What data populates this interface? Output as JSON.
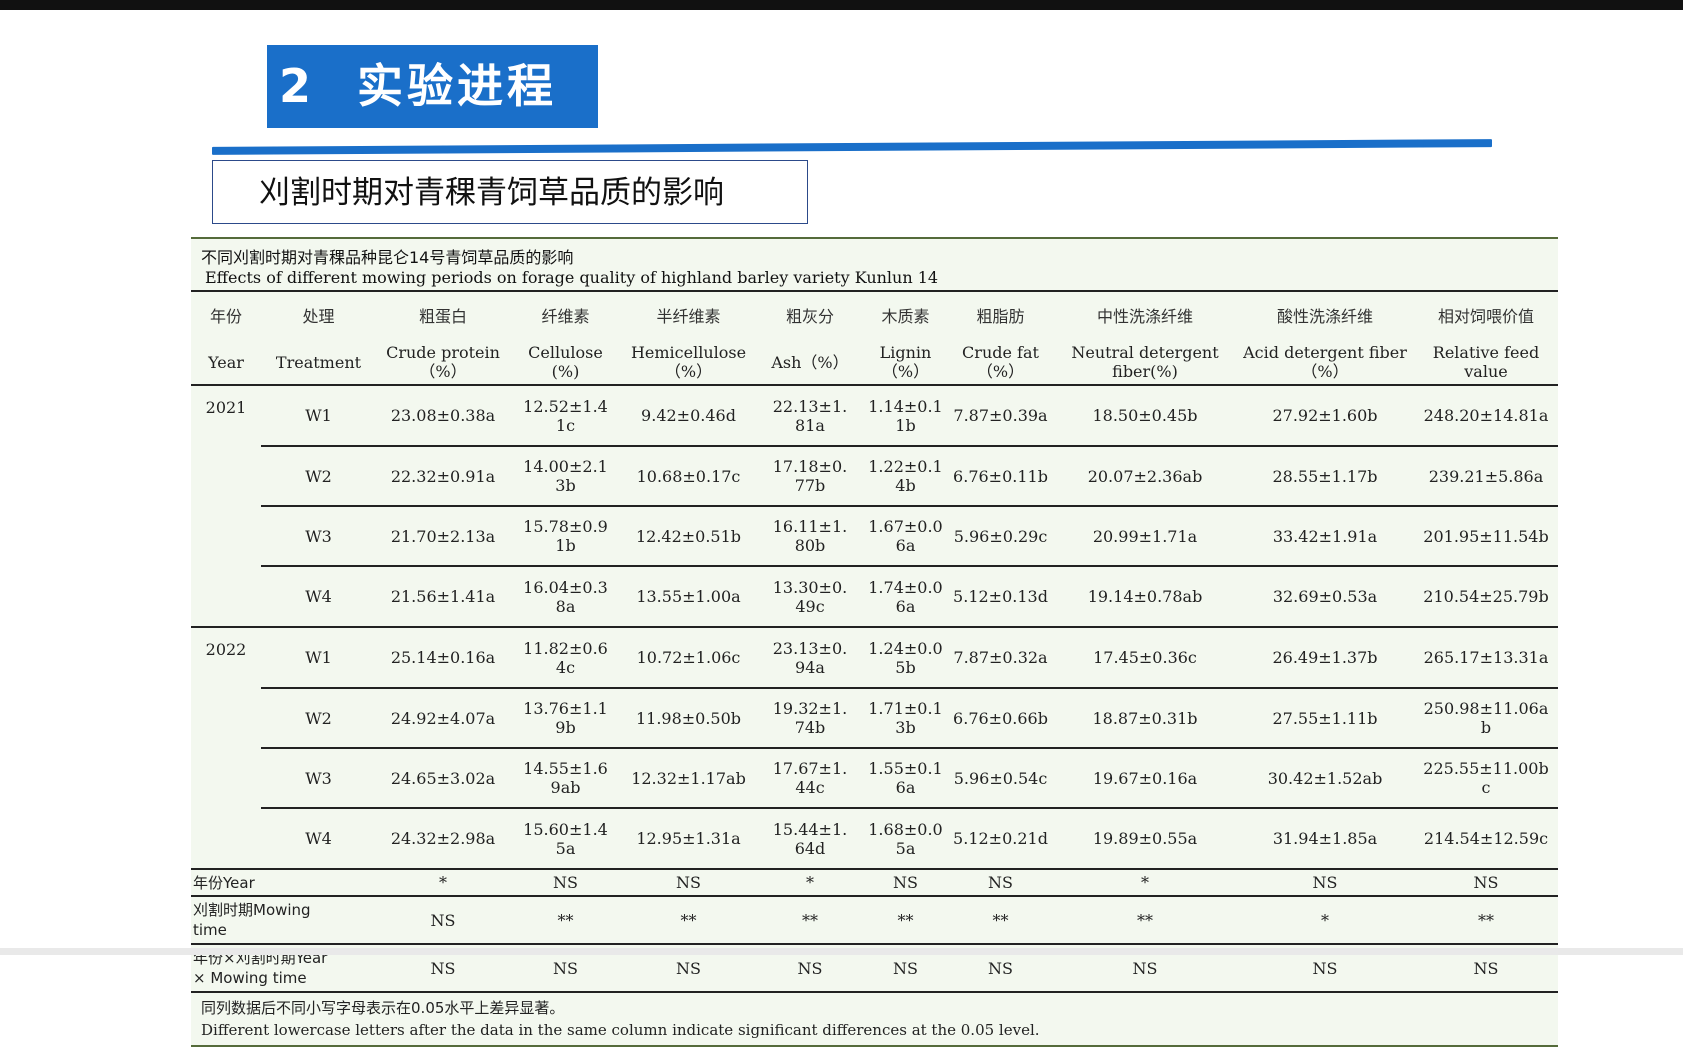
{
  "section": {
    "number": "2",
    "title": "实验进程"
  },
  "subtitle": "刈割时期对青稞青饲草品质的影响",
  "table": {
    "caption_cn": "不同刈割时期对青稞品种昆仑14号青饲草品质的影响",
    "caption_en": "Effects of different mowing periods on forage quality of highland barley variety Kunlun 14",
    "headers_cn": [
      "年份",
      "处理",
      "粗蛋白",
      "纤维素",
      "半纤维素",
      "粗灰分",
      "木质素",
      "粗脂肪",
      "中性洗涤纤维",
      "酸性洗涤纤维",
      "相对饲喂价值"
    ],
    "headers_en": [
      "Year",
      "Treatment",
      "Crude protein\n（%）",
      "Cellulose\n(%)",
      "Hemicellulose\n（%）",
      "Ash（%）",
      "Lignin\n（%）",
      "Crude fat\n（%）",
      "Neutral detergent\nfiber(%)",
      "Acid detergent fiber\n（%）",
      "Relative feed\nvalue"
    ],
    "rows": [
      [
        "2021",
        "W1",
        "23.08±0.38a",
        "12.52±1.4\n1c",
        "9.42±0.46d",
        "22.13±1.\n81a",
        "1.14±0.1\n1b",
        "7.87±0.39a",
        "18.50±0.45b",
        "27.92±1.60b",
        "248.20±14.81a"
      ],
      [
        "",
        "W2",
        "22.32±0.91a",
        "14.00±2.1\n3b",
        "10.68±0.17c",
        "17.18±0.\n77b",
        "1.22±0.1\n4b",
        "6.76±0.11b",
        "20.07±2.36ab",
        "28.55±1.17b",
        "239.21±5.86a"
      ],
      [
        "",
        "W3",
        "21.70±2.13a",
        "15.78±0.9\n1b",
        "12.42±0.51b",
        "16.11±1.\n80b",
        "1.67±0.0\n6a",
        "5.96±0.29c",
        "20.99±1.71a",
        "33.42±1.91a",
        "201.95±11.54b"
      ],
      [
        "",
        "W4",
        "21.56±1.41a",
        "16.04±0.3\n8a",
        "13.55±1.00a",
        "13.30±0.\n49c",
        "1.74±0.0\n6a",
        "5.12±0.13d",
        "19.14±0.78ab",
        "32.69±0.53a",
        "210.54±25.79b"
      ],
      [
        "2022",
        "W1",
        "25.14±0.16a",
        "11.82±0.6\n4c",
        "10.72±1.06c",
        "23.13±0.\n94a",
        "1.24±0.0\n5b",
        "7.87±0.32a",
        "17.45±0.36c",
        "26.49±1.37b",
        "265.17±13.31a"
      ],
      [
        "",
        "W2",
        "24.92±4.07a",
        "13.76±1.1\n9b",
        "11.98±0.50b",
        "19.32±1.\n74b",
        "1.71±0.1\n3b",
        "6.76±0.66b",
        "18.87±0.31b",
        "27.55±1.11b",
        "250.98±11.06a\nb"
      ],
      [
        "",
        "W3",
        "24.65±3.02a",
        "14.55±1.6\n9ab",
        "12.32±1.17ab",
        "17.67±1.\n44c",
        "1.55±0.1\n6a",
        "5.96±0.54c",
        "19.67±0.16a",
        "30.42±1.52ab",
        "225.55±11.00b\nc"
      ],
      [
        "",
        "W4",
        "24.32±2.98a",
        "15.60±1.4\n5a",
        "12.95±1.31a",
        "15.44±1.\n64d",
        "1.68±0.0\n5a",
        "5.12±0.21d",
        "19.89±0.55a",
        "31.94±1.85a",
        "214.54±12.59c"
      ]
    ],
    "stats": [
      {
        "label": "年份Year",
        "values": [
          "*",
          "NS",
          "NS",
          "*",
          "NS",
          "NS",
          "*",
          "NS",
          "NS"
        ]
      },
      {
        "label": "刈割时期Mowing\ntime",
        "values": [
          "NS",
          "**",
          "**",
          "**",
          "**",
          "**",
          "**",
          "*",
          "**"
        ]
      },
      {
        "label": "年份×刈割时期Year\n× Mowing time",
        "values": [
          "NS",
          "NS",
          "NS",
          "NS",
          "NS",
          "NS",
          "NS",
          "NS",
          "NS"
        ]
      }
    ],
    "note_cn": "同列数据后不同小写字母表示在0.05水平上差异显著。",
    "note_en": "Different lowercase letters after the data in the same column indicate significant differences at the 0.05 level."
  }
}
